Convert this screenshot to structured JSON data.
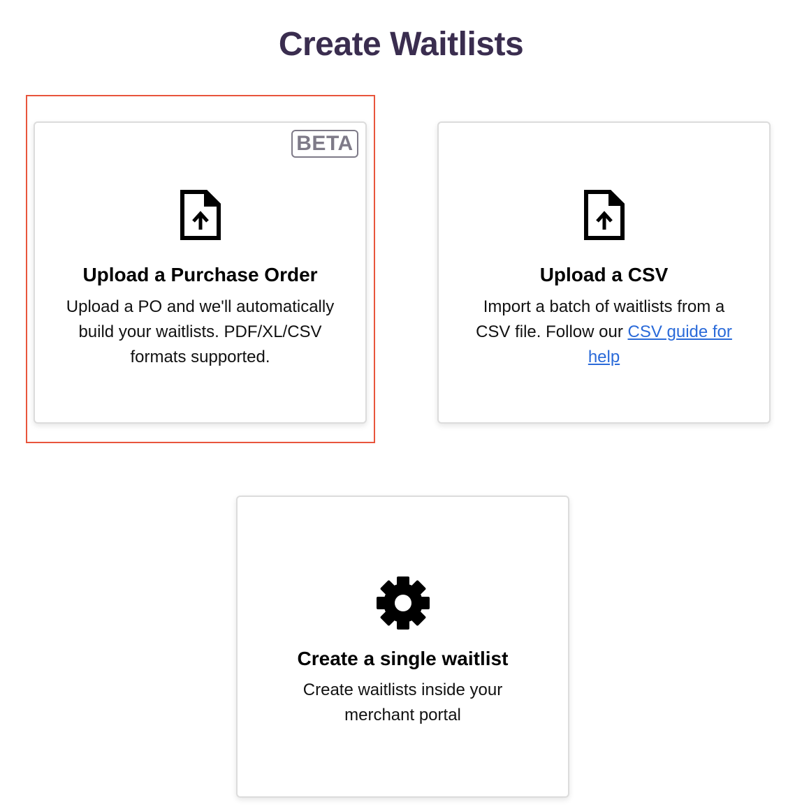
{
  "page": {
    "title": "Create Waitlists"
  },
  "cards": {
    "purchase_order": {
      "badge": "BETA",
      "icon": "file-upload-icon",
      "title": "Upload a Purchase Order",
      "description": "Upload a PO and we'll automatically build your waitlists. PDF/XL/CSV formats supported."
    },
    "csv": {
      "icon": "file-upload-icon",
      "title": "Upload a CSV",
      "description_prefix": "Import a batch of waitlists from a CSV file. Follow our ",
      "link_text": "CSV guide for help"
    },
    "single": {
      "icon": "gear-icon",
      "title": "Create a single waitlist",
      "description": "Create waitlists inside your merchant portal"
    }
  },
  "colors": {
    "title": "#3a2d4f",
    "highlight": "#e8553c",
    "link": "#2a6ad9",
    "badge": "#7e7a88"
  }
}
